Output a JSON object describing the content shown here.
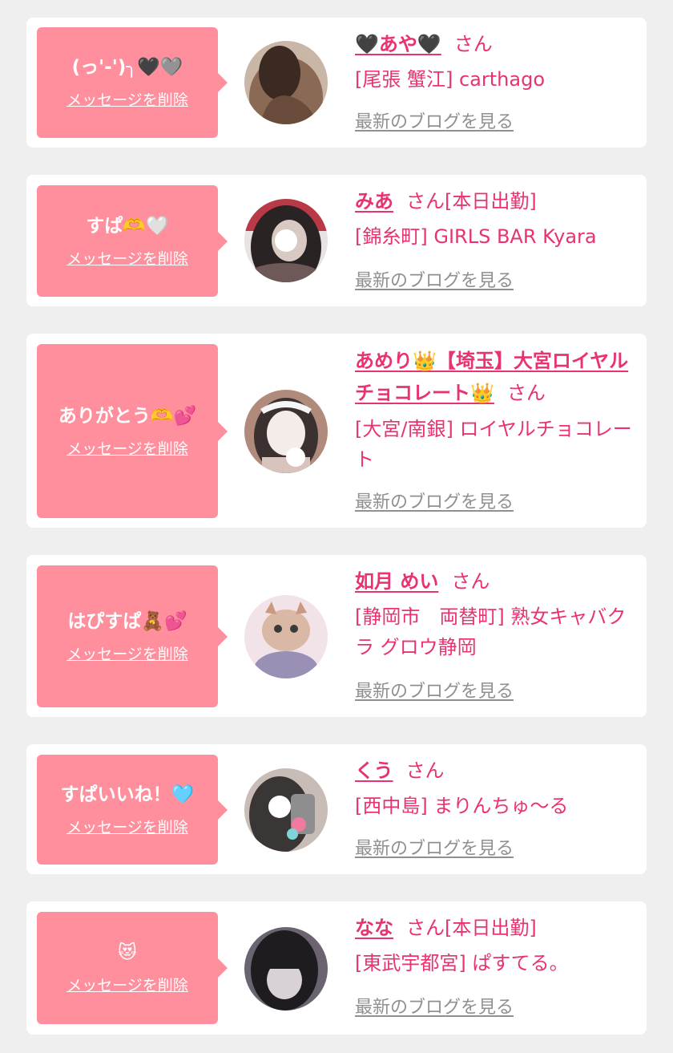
{
  "common": {
    "delete_label": "メッセージを削除",
    "blog_label": "最新のブログを見る",
    "san": "さん"
  },
  "entries": [
    {
      "message": "(っ'-')╮🖤🩶",
      "name": "🖤あや🖤",
      "tag": "",
      "shop": "[尾張 蟹江] carthago",
      "avatar_colors": [
        "#3a2a22",
        "#8a6a55",
        "#c9b6a6"
      ]
    },
    {
      "message": "すぱ🫶🤍",
      "name": "みあ",
      "tag": "[本日出勤]",
      "shop": "[錦糸町] GIRLS BAR Kyara",
      "avatar_colors": [
        "#2a2324",
        "#6d5a58",
        "#e8e2e2"
      ]
    },
    {
      "message": "ありがとう🫶💕",
      "name": "あめり👑【埼玉】大宮ロイヤルチョコレート👑",
      "tag": "",
      "shop": "[大宮/南銀] ロイヤルチョコレート",
      "avatar_colors": [
        "#3b3131",
        "#d9c3bd",
        "#f3ece8"
      ]
    },
    {
      "message": "はぴすぱ🧸💕",
      "name": "如月 めい",
      "tag": "",
      "shop": "[静岡市　両替町] 熟女キャバクラ グロウ静岡",
      "avatar_colors": [
        "#d9b9a5",
        "#f1e3e8",
        "#9a8fb5"
      ]
    },
    {
      "message": "すぱいいね！🩵",
      "name": "くう",
      "tag": "",
      "shop": "[西中島] まりんちゅ〜る",
      "avatar_colors": [
        "#3a3636",
        "#c8bcb6",
        "#f07aa0"
      ]
    },
    {
      "message": "😻",
      "name": "なな",
      "tag": "[本日出勤]",
      "shop": "[東武宇都宮] ぱすてる。",
      "avatar_colors": [
        "#1e1c1f",
        "#6b6470",
        "#d8d1d6"
      ]
    }
  ]
}
